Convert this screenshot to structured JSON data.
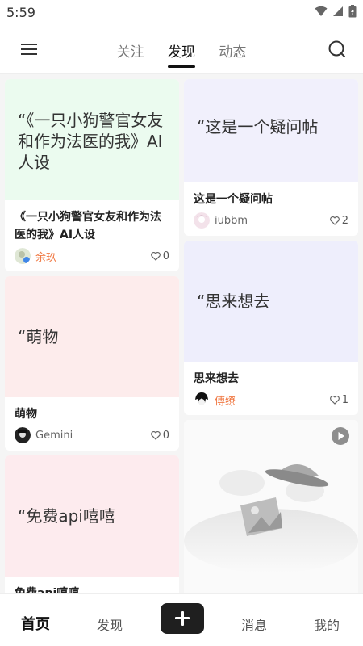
{
  "status_bar": {
    "time": "5:59"
  },
  "header": {
    "tabs": [
      {
        "label": "关注",
        "active": false
      },
      {
        "label": "发现",
        "active": true
      },
      {
        "label": "动态",
        "active": false
      }
    ],
    "menu_icon": "hamburger-menu-icon",
    "search_icon": "search-icon"
  },
  "feed": {
    "left": [
      {
        "cover_text": "“《一只小狗警官女友和作为法医的我》AI人设",
        "title": "《一只小狗警官女友和作为法医的我》AI人设",
        "author": "余玖",
        "likes": "0",
        "cover_color": "#ebfbef"
      },
      {
        "cover_text": "“萌物",
        "title": "萌物",
        "author": "Gemini",
        "likes": "0",
        "cover_color": "#fdecec"
      },
      {
        "cover_text": "“免费api嘻嘻",
        "title": "免费api嘻嘻",
        "author": "",
        "likes": "",
        "cover_color": "#fdebee"
      }
    ],
    "right": [
      {
        "cover_text": "“这是一个疑问帖",
        "title": "这是一个疑问帖",
        "author": "iubbm",
        "likes": "2",
        "cover_color": "#f1f0fc"
      },
      {
        "cover_text": "“思来想去",
        "title": "思来想去",
        "author": "傅缭",
        "likes": "1",
        "cover_color": "#eeeefc"
      }
    ]
  },
  "bottom_nav": {
    "items": [
      {
        "label": "首页",
        "active": true
      },
      {
        "label": "发现",
        "active": false
      },
      {
        "label": "消息",
        "active": false
      },
      {
        "label": "我的",
        "active": false
      }
    ],
    "add_icon": "plus-icon"
  },
  "colors": {
    "accent": "#111111",
    "author_highlight": "#f07a45"
  }
}
